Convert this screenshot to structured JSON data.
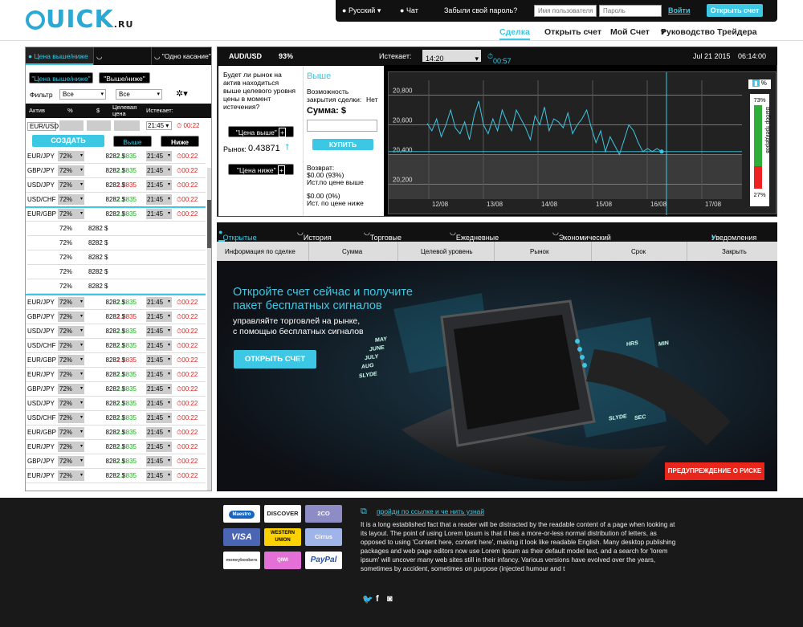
{
  "logo": {
    "text": "UICK",
    "suffix": ".RU"
  },
  "topbar": {
    "language": "Русский",
    "chat": "Чат",
    "forgot": "Забыли свой пароль?",
    "username_placeholder": "Имя пользователя",
    "password_placeholder": "Пароль",
    "login": "Войти",
    "open_account": "Открыть счет"
  },
  "nav": {
    "items": [
      "Сделка",
      "Открыть счет",
      "Мой Счет",
      "Руководство Трейдера"
    ]
  },
  "left": {
    "tabs": [
      "Цена выше/ниже",
      "Краткосрочные",
      "Одно касание"
    ],
    "pills": [
      "\"Цена выше/ниже\"",
      "\"Выше/ниже\""
    ],
    "filter_label": "Фильтр",
    "filter_value": "Все",
    "filter_value2": "Все",
    "headers": [
      "Актив",
      "%",
      "$",
      "Целевая цена",
      "Истекает:"
    ],
    "new_asset": "EUR/USD",
    "new_time": "21:45",
    "new_countdown": "00:22",
    "create": "СОЗДАТЬ",
    "higher": "Выше",
    "lower": "Ниже",
    "rows_top": [
      {
        "a": "EUR/JPY",
        "p": "72%",
        "s": "8282 $",
        "v": "1.3835",
        "c": "g",
        "t": "21:45",
        "cd": "00:22"
      },
      {
        "a": "GBP/JPY",
        "p": "72%",
        "s": "8282 $",
        "v": "1.3835",
        "c": "g",
        "t": "21:45",
        "cd": "00:22"
      },
      {
        "a": "USD/JPY",
        "p": "72%",
        "s": "8282 $",
        "v": "1.3835",
        "c": "r",
        "t": "21:45",
        "cd": "00:22"
      },
      {
        "a": "USD/CHF",
        "p": "72%",
        "s": "8282 $",
        "v": "1.3835",
        "c": "g",
        "t": "21:45",
        "cd": "00:22"
      },
      {
        "a": "EUR/GBP",
        "p": "72%",
        "s": "8282 $",
        "v": "1.3835",
        "c": "g",
        "t": "21:45",
        "cd": "00:22"
      }
    ],
    "rows_expanded": [
      {
        "p": "72%",
        "s": "8282 $"
      },
      {
        "p": "72%",
        "s": "8282 $"
      },
      {
        "p": "72%",
        "s": "8282 $"
      },
      {
        "p": "72%",
        "s": "8282 $"
      },
      {
        "p": "72%",
        "s": "8282 $"
      }
    ],
    "rows_bottom": [
      {
        "a": "EUR/JPY",
        "p": "72%",
        "s": "8282 $",
        "v": "1.3835",
        "c": "g",
        "t": "21:45",
        "cd": "00:22"
      },
      {
        "a": "GBP/JPY",
        "p": "72%",
        "s": "8282 $",
        "v": "1.3835",
        "c": "r",
        "t": "21:45",
        "cd": "00:22"
      },
      {
        "a": "USD/JPY",
        "p": "72%",
        "s": "8282 $",
        "v": "1.3835",
        "c": "g",
        "t": "21:45",
        "cd": "00:22"
      },
      {
        "a": "USD/CHF",
        "p": "72%",
        "s": "8282 $",
        "v": "1.3835",
        "c": "g",
        "t": "21:45",
        "cd": "00:22"
      },
      {
        "a": "EUR/GBP",
        "p": "72%",
        "s": "8282 $",
        "v": "1.3835",
        "c": "r",
        "t": "21:45",
        "cd": "00:22"
      },
      {
        "a": "EUR/JPY",
        "p": "72%",
        "s": "8282 $",
        "v": "1.3835",
        "c": "g",
        "t": "21:45",
        "cd": "00:22"
      },
      {
        "a": "GBP/JPY",
        "p": "72%",
        "s": "8282 $",
        "v": "1.3835",
        "c": "g",
        "t": "21:45",
        "cd": "00:22"
      },
      {
        "a": "USD/JPY",
        "p": "72%",
        "s": "8282 $",
        "v": "1.3835",
        "c": "g",
        "t": "21:45",
        "cd": "00:22"
      },
      {
        "a": "USD/CHF",
        "p": "72%",
        "s": "8282 $",
        "v": "1.3835",
        "c": "g",
        "t": "21:45",
        "cd": "00:22"
      },
      {
        "a": "EUR/GBP",
        "p": "72%",
        "s": "8282 $",
        "v": "1.3835",
        "c": "g",
        "t": "21:45",
        "cd": "00:22"
      },
      {
        "a": "EUR/JPY",
        "p": "72%",
        "s": "8282 $",
        "v": "1.3835",
        "c": "g",
        "t": "21:45",
        "cd": "00:22"
      },
      {
        "a": "GBP/JPY",
        "p": "72%",
        "s": "8282 $",
        "v": "1.3835",
        "c": "g",
        "t": "21:45",
        "cd": "00:22"
      },
      {
        "a": "EUR/JPY",
        "p": "72%",
        "s": "8282 $",
        "v": "1.3835",
        "c": "g",
        "t": "21:45",
        "cd": "00:22"
      }
    ]
  },
  "trade": {
    "asset": "AUD/USD",
    "percent": "93%",
    "expires_label": "Истекает:",
    "expires_value": "14:20",
    "countdown": "00:57",
    "date": "Jul 21 2015",
    "time": "06:14:00",
    "question": "Будет ли рынок на актив находиться выше целевого уровня цены в момент истечения?",
    "btn_higher": "\"Цена выше\"",
    "btn_lower": "\"Цена ниже\"",
    "market_label": "Рынок:",
    "market_value": "0.43871",
    "direction": "Выше",
    "close_label": "Возможность закрытия сделки:",
    "close_value": "Нет",
    "sum_label": "Сумма: $",
    "buy": "КУПИТЬ",
    "return_label": "Возврат:",
    "return_value": "$0.00 (93%)",
    "return_note": "Ист.по цене выше",
    "loss_value": "$0.00 (0%)",
    "loss_note": "Ист. по цене ниже"
  },
  "gauge": {
    "top": "73%",
    "bottom": "27%",
    "label": "Выбор трейдеров",
    "up_fraction": 0.73
  },
  "chart_data": {
    "type": "line",
    "x": [
      "12/08",
      "13/08",
      "14/08",
      "15/08",
      "16/08",
      "17/08"
    ],
    "ylim": [
      20100,
      20900
    ],
    "yticks": [
      "20,800",
      "20,600",
      "20,400",
      "20,200"
    ],
    "series": [
      {
        "values": [
          20610,
          20560,
          20640,
          20520,
          20600,
          20700,
          20580,
          20540,
          20620,
          20500,
          20660,
          20760,
          20600,
          20540,
          20640,
          20560,
          20700,
          20620,
          20560,
          20700,
          20640,
          20580,
          20500,
          20660,
          20600,
          20720,
          20560,
          20640,
          20620,
          20580,
          20680,
          20540,
          20600,
          20640,
          20700,
          20580,
          20480,
          20560,
          20420,
          20520,
          20460,
          20400,
          20500,
          20600,
          20560,
          20480,
          20420,
          20440,
          20420,
          20440,
          20420
        ]
      }
    ]
  },
  "bottom_tabs": {
    "items": [
      "Открытые сделки (0)",
      "История сделок",
      "Торговые оповещения",
      "Ежедневные обзоры рынков",
      "Экономический календарь"
    ],
    "notifications": "Уведомления (0)",
    "headers": [
      "Информация по сделке",
      "Сумма",
      "Целевой уровень",
      "Рынок",
      "Срок",
      "Закрыть"
    ]
  },
  "banner": {
    "title1": "Откройте счет сейчас и получите",
    "title2": "пакет бесплатных сигналов",
    "sub1": "управляйте торговлей на рынке,",
    "sub2": "с помощью бесплатных сигналов",
    "cta": "ОТКРЫТЬ СЧЕТ",
    "risk": "ПРЕДУПРЕЖДЕНИЕ О РИСКЕ",
    "screen_words": [
      "MAY",
      "JUNE",
      "JULY",
      "AUG",
      "SLYDE",
      "HRS",
      "MIN",
      "SEC",
      "SLYDE"
    ]
  },
  "footer": {
    "payments": [
      "Maestro",
      "DISCOVER",
      "2CO",
      "VISA",
      "WESTERN UNION",
      "Cirrus",
      "moneybookers",
      "QIWI",
      "PayPal"
    ],
    "link": "пройди по ссылке и че нить узнай",
    "text": "It is a long established fact that a reader will be distracted by the readable content of a page when looking at its layout. The point of using Lorem Ipsum is that it has a more-or-less normal distribution of letters, as opposed to using 'Content here, content here', making it look like readable English. Many desktop publishing packages and web page editors now use Lorem Ipsum as their default model text, and a search for 'lorem ipsum' will uncover many web sites still in their infancy. Various versions have evolved over the years, sometimes by accident, sometimes on purpose (injected humour and t",
    "social": [
      "twitter-icon",
      "facebook-icon",
      "instagram-icon"
    ]
  }
}
